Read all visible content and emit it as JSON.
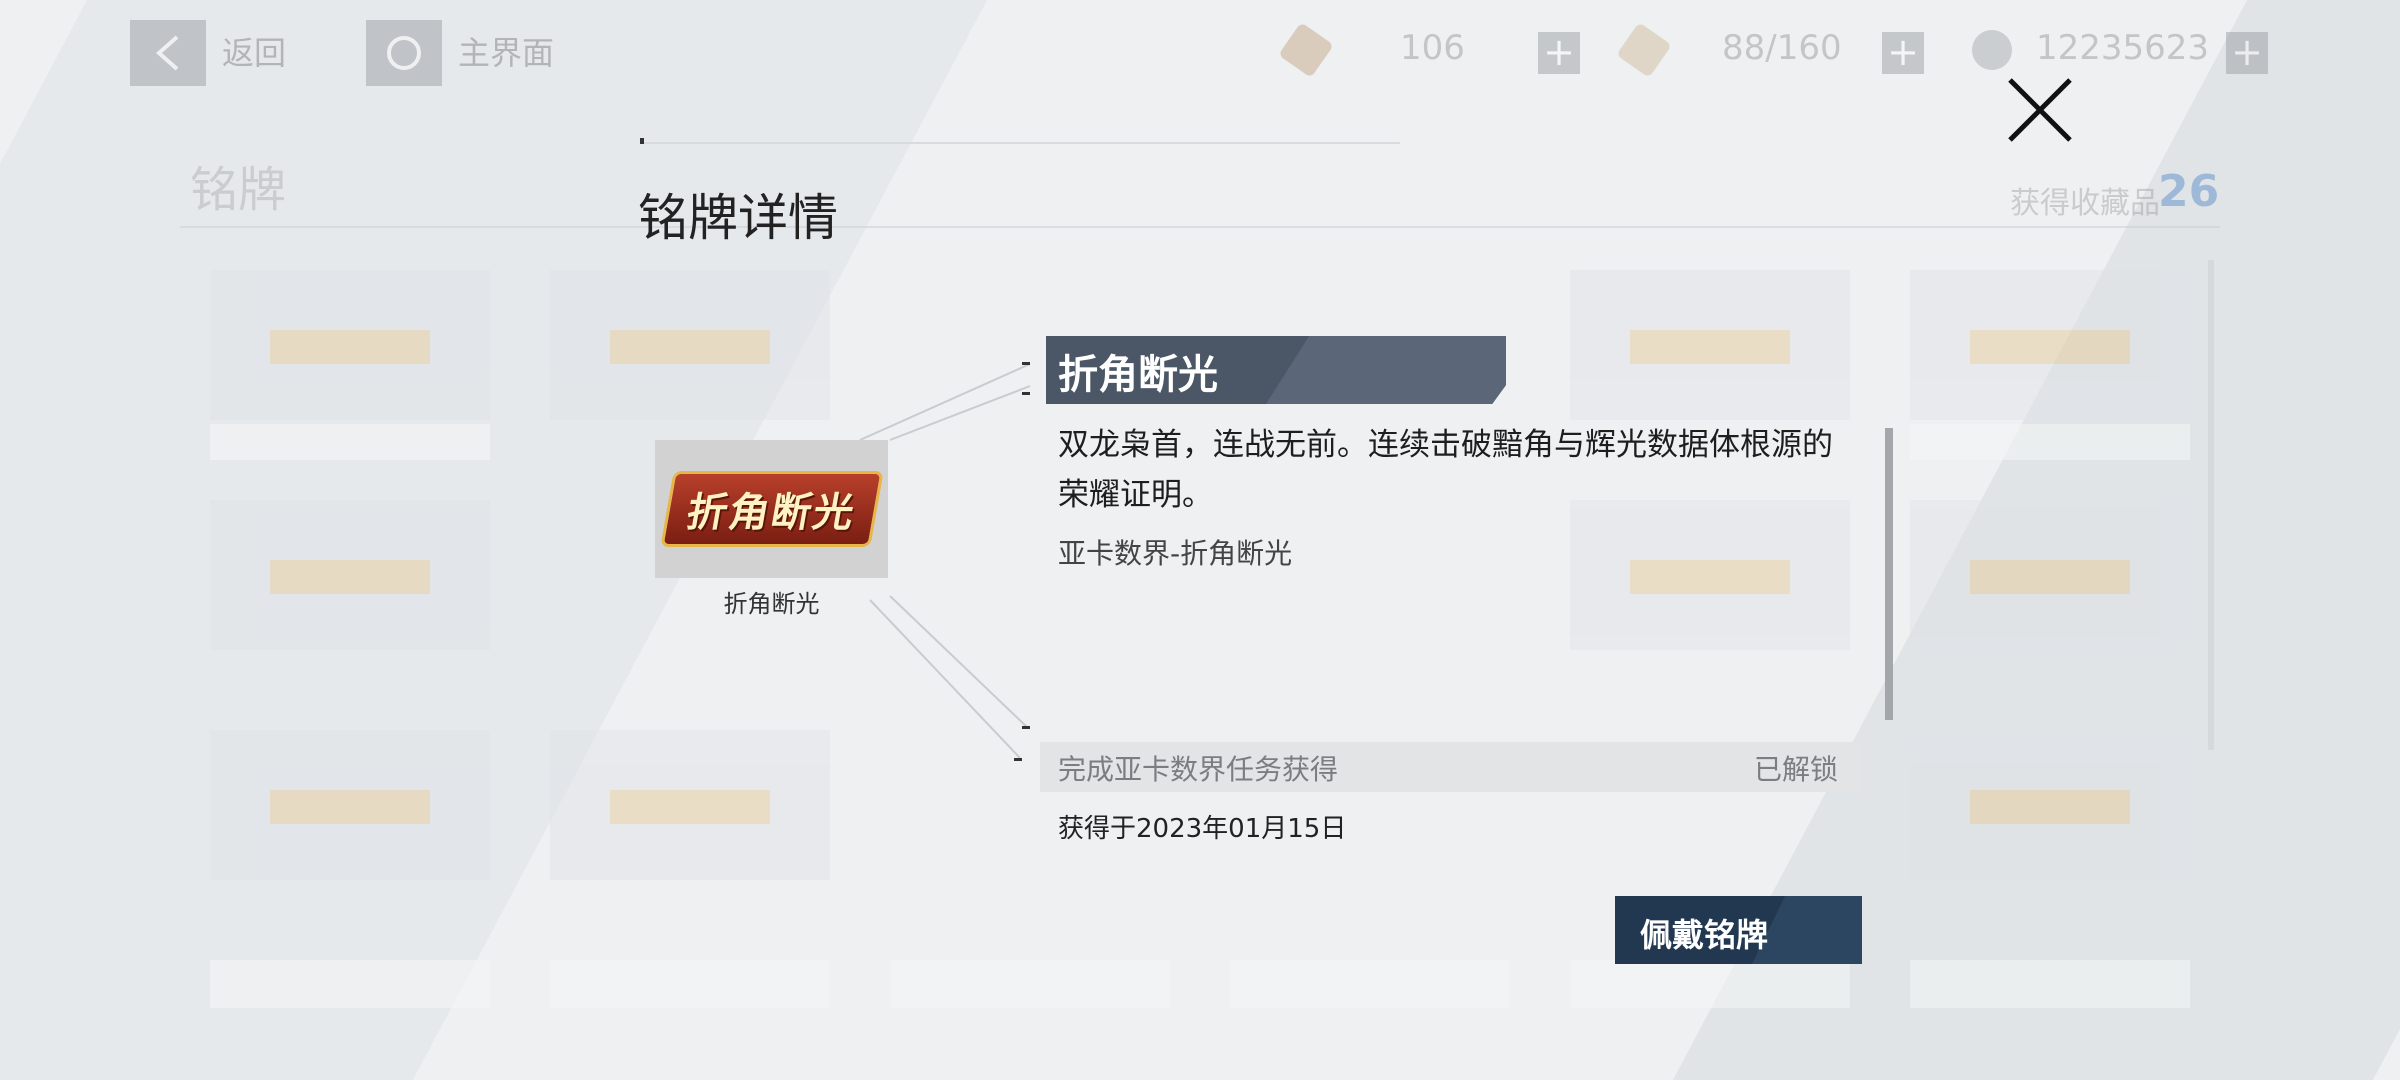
{
  "topbar": {
    "back_label": "返回",
    "home_label": "主界面",
    "resources": [
      {
        "icon": "ticket-icon",
        "value": "106"
      },
      {
        "icon": "stamina-icon",
        "value": "88/160"
      },
      {
        "icon": "coin-icon",
        "value": "12235623"
      }
    ]
  },
  "background_page": {
    "title": "铭牌",
    "collected_label": "获得收藏品",
    "collected_count": "26"
  },
  "modal": {
    "title": "铭牌详情",
    "badge": {
      "art_text": "折角断光",
      "thumb_label": "折角断光",
      "name": "折角断光",
      "description": "双龙枭首，连战无前。连续击破黯角与辉光数据体根源的荣耀证明。",
      "source": "亚卡数界-折角断光",
      "unlock_condition": "完成亚卡数界任务获得",
      "unlock_status": "已解锁",
      "obtained_date": "获得于2023年01月15日"
    },
    "wear_button_label": "佩戴铭牌"
  },
  "colors": {
    "banner": "#4b5666",
    "wear_button": "#223850",
    "count_accent": "#4e86c4"
  }
}
